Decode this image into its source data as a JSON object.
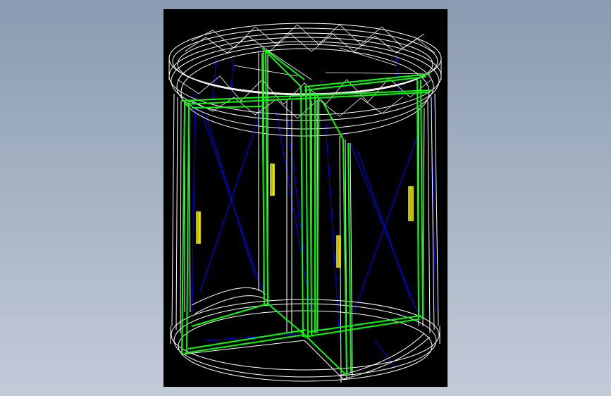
{
  "viewport": {
    "background": "#000000",
    "model": "revolving-door-wireframe",
    "colors": {
      "frame": "#ffffff",
      "glass": "#0000ff",
      "wings": "#00ff00",
      "handles": "#ffff00"
    }
  }
}
